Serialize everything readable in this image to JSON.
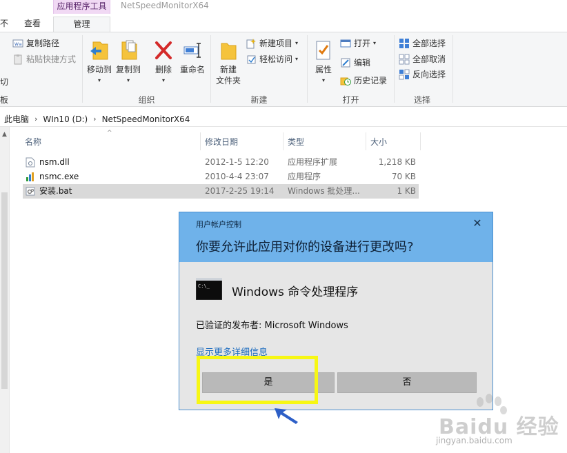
{
  "window": {
    "context_tab_header": "应用程序工具",
    "title": "NetSpeedMonitorX64",
    "tabs": {
      "file": "不",
      "view": "查看",
      "manage": "管理"
    }
  },
  "ribbon": {
    "clipboard": {
      "cut_partial": "切",
      "paste_partial": "板",
      "copy_path": "复制路径",
      "paste_shortcut": "粘贴快捷方式"
    },
    "organize": {
      "label": "组织",
      "move_to": "移动到",
      "copy_to": "复制到",
      "delete": "删除",
      "rename": "重命名"
    },
    "new": {
      "label": "新建",
      "new_folder_line1": "新建",
      "new_folder_line2": "文件夹",
      "new_item": "新建项目",
      "easy_access": "轻松访问"
    },
    "open": {
      "label": "打开",
      "properties": "属性",
      "open": "打开",
      "edit": "编辑",
      "history": "历史记录"
    },
    "select": {
      "label": "选择",
      "select_all": "全部选择",
      "select_none": "全部取消",
      "invert": "反向选择"
    }
  },
  "address": {
    "crumbs": [
      "此电脑",
      "WIn10 (D:)",
      "NetSpeedMonitorX64"
    ]
  },
  "file_list": {
    "columns": {
      "name": "名称",
      "modified": "修改日期",
      "type": "类型",
      "size": "大小"
    },
    "rows": [
      {
        "name": "nsm.dll",
        "modified": "2012-1-5 12:20",
        "type": "应用程序扩展",
        "size": "1,218 KB"
      },
      {
        "name": "nsmc.exe",
        "modified": "2010-4-4 23:07",
        "type": "应用程序",
        "size": "70 KB"
      },
      {
        "name": "安装.bat",
        "modified": "2017-2-25 19:14",
        "type": "Windows 批处理...",
        "size": "1 KB"
      }
    ]
  },
  "uac": {
    "small_title": "用户帐户控制",
    "question": "你要允许此应用对你的设备进行更改吗?",
    "app_name": "Windows 命令处理程序",
    "publisher": "已验证的发布者: Microsoft Windows",
    "more_details": "显示更多详细信息",
    "yes": "是",
    "no": "否",
    "close_glyph": "✕"
  },
  "watermark": {
    "brand": "Baidu 经验",
    "url": "jingyan.baidu.com"
  },
  "colors": {
    "uac_header": "#6fb2ea",
    "highlight": "#f7f714",
    "context_tab": "#f1d9f4",
    "link": "#1b6bbf"
  }
}
